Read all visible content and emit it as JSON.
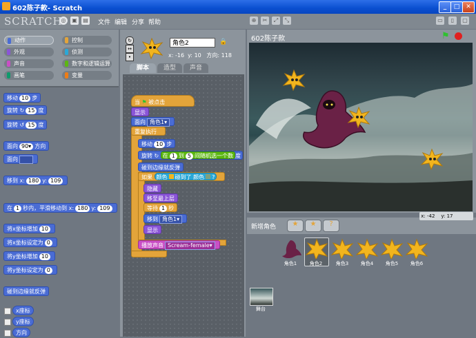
{
  "window": {
    "title": "602陈子款- Scratch",
    "min": "_",
    "max": "□",
    "close": "✕"
  },
  "menu": {
    "logo": "SCRATCH",
    "file": "文件",
    "edit": "编辑",
    "share": "分享",
    "help": "帮助"
  },
  "categories": [
    {
      "label": "动作",
      "color": "#4a6cd4",
      "selected": true
    },
    {
      "label": "控制",
      "color": "#e3a43a"
    },
    {
      "label": "外观",
      "color": "#8a55d7"
    },
    {
      "label": "侦测",
      "color": "#2aa8d7"
    },
    {
      "label": "声音",
      "color": "#c94fc5"
    },
    {
      "label": "数字和逻辑运算",
      "color": "#5cb712"
    },
    {
      "label": "画笔",
      "color": "#0e9a6c"
    },
    {
      "label": "变量",
      "color": "#ee7d16"
    }
  ],
  "palette": {
    "move": "移动",
    "move_val": "10",
    "step": "步",
    "turn_cw": "旋转 ↻",
    "turn_cw_val": "15",
    "turn_ccw": "旋转 ↺",
    "turn_ccw_val": "15",
    "degree": "度",
    "point_dir": "面向",
    "point_dir_val": "90▾",
    "direction_word": "方向",
    "point_towards": "面向",
    "goto_xy": "移到 x:",
    "goto_x": "180",
    "goto_y_label": "y:",
    "goto_y": "109",
    "glide": "在",
    "glide_secs": "1",
    "glide_mid": "秒内，平滑移动到 x:",
    "glide_x": "180",
    "glide_y_label": "y:",
    "glide_y": "109",
    "change_x": "将x坐标增加",
    "change_x_val": "10",
    "set_x": "将x坐标设定为",
    "set_x_val": "0",
    "change_y": "将y坐标增加",
    "change_y_val": "10",
    "set_y": "将y坐标设定为",
    "set_y_val": "0",
    "bounce": "碰到边缘就反弹",
    "xpos": "x座标",
    "ypos": "y座标",
    "direction": "方向"
  },
  "sprite_info": {
    "name": "角色2",
    "x_label": "x:",
    "x": "-16",
    "y_label": "y:",
    "y": "10",
    "dir_label": "方向:",
    "dir": "118"
  },
  "tabs": [
    "脚本",
    "造型",
    "声音"
  ],
  "script": {
    "when_clicked": "当",
    "clicked": "被点击",
    "show": "显示",
    "point_towards": "面向",
    "sprite1": "角色1▾",
    "forever": "重复执行",
    "move": "移动",
    "move_val": "10",
    "step": "步",
    "turn": "旋转 ↻",
    "pick": "在",
    "from": "1",
    "to_label": "到",
    "to": "5",
    "between": "间随机选一个数",
    "degree": "度",
    "bounce": "碰到边缘就反弹",
    "if": "如果",
    "color_touch": "颜色",
    "touching_color": "碰到了 颜色",
    "q": "?",
    "hide": "隐藏",
    "go_front": "移至最上层",
    "wait": "等待",
    "wait_val": "1",
    "secs": "秒",
    "goto": "移到",
    "goto_target": "角色1▾",
    "show2": "显示",
    "play_sound": "播放声音",
    "sound_name": "Scream-female▾"
  },
  "stage": {
    "title": "602陈子款",
    "mouse_x_label": "x:",
    "mouse_x": "-42",
    "mouse_y_label": "y:",
    "mouse_y": "17"
  },
  "new_sprite": "新增角色",
  "sprites": [
    "角色1",
    "角色2",
    "角色3",
    "角色4",
    "角色5",
    "角色6"
  ],
  "stage_thumb": "舞台"
}
